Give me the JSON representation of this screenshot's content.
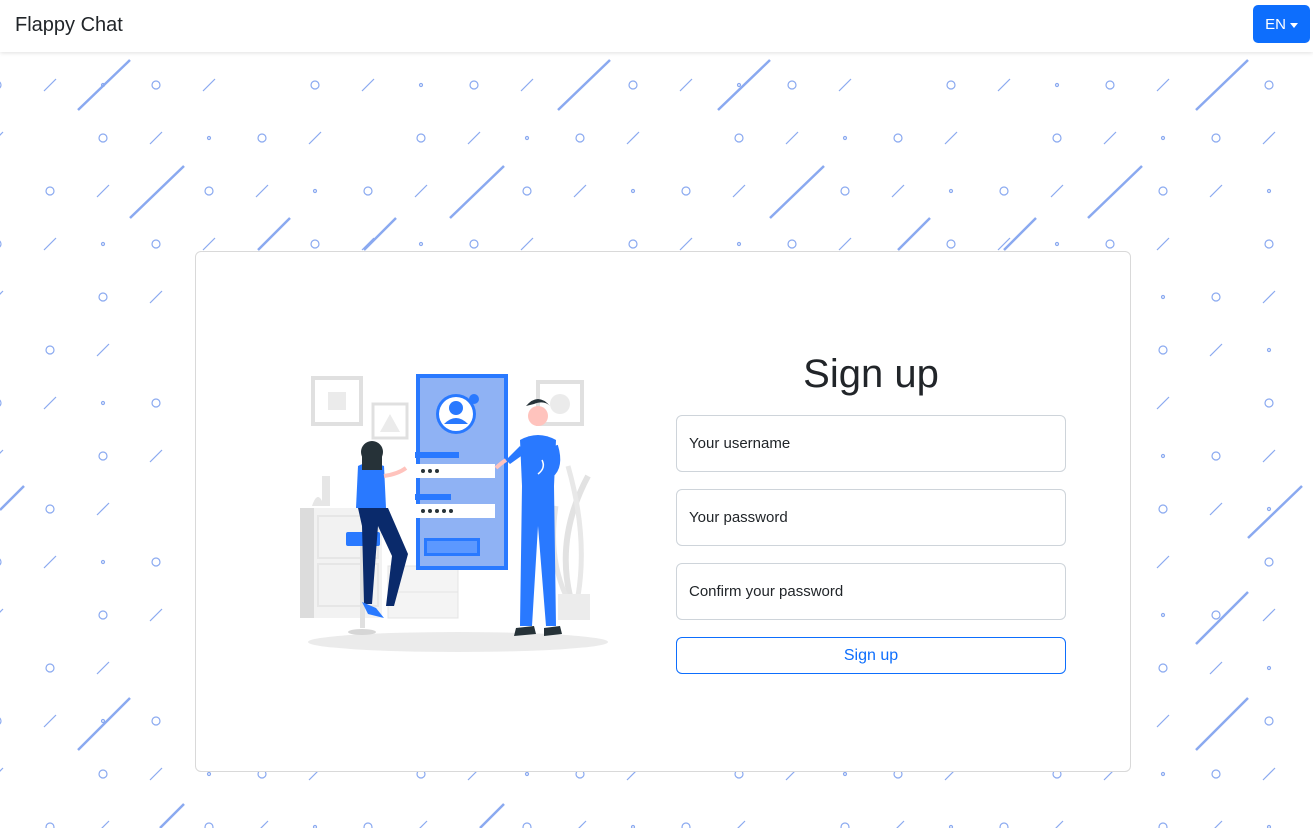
{
  "navbar": {
    "brand": "Flappy Chat",
    "language": "EN"
  },
  "form": {
    "title": "Sign up",
    "username_placeholder": "Your username",
    "password_placeholder": "Your password",
    "confirm_placeholder": "Confirm your password",
    "submit_label": "Sign up"
  },
  "colors": {
    "accent": "#0d6efd",
    "pattern": "#8aa9f0"
  }
}
